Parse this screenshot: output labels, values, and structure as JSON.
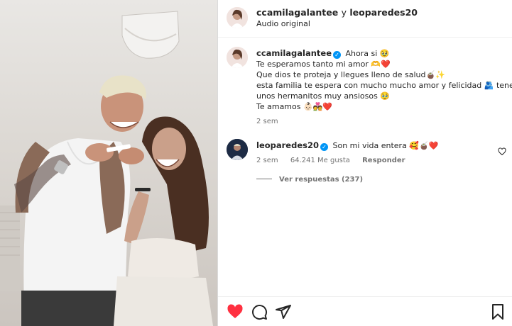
{
  "header": {
    "user1": "ccamilagalantee",
    "joiner": "y",
    "user2": "leoparedes20",
    "subtitle": "Audio original"
  },
  "caption": {
    "username": "ccamilagalantee",
    "lines": [
      "Ahora si 🥹",
      "Te esperamos tanto mi amor 🫶❤️",
      "Que dios te proteja y llegues lleno de salud🧉✨",
      "esta familia te espera con mucho mucho amor y felicidad 🫂 tenes",
      "unos hermanitos muy ansiosos 🥹",
      "Te amamos 👶🏻💑❤️"
    ],
    "time": "2 sem"
  },
  "comment": {
    "username": "leoparedes20",
    "text": "Son mi vida entera 🥰🧉❤️",
    "time": "2 sem",
    "likes": "64.241 Me gusta",
    "reply": "Responder",
    "view_replies": "Ver respuestas (237)"
  },
  "icons": {
    "like": "heart-filled-icon",
    "comment": "comment-icon",
    "share": "share-icon",
    "save": "bookmark-icon",
    "like_color": "#ff3040"
  }
}
